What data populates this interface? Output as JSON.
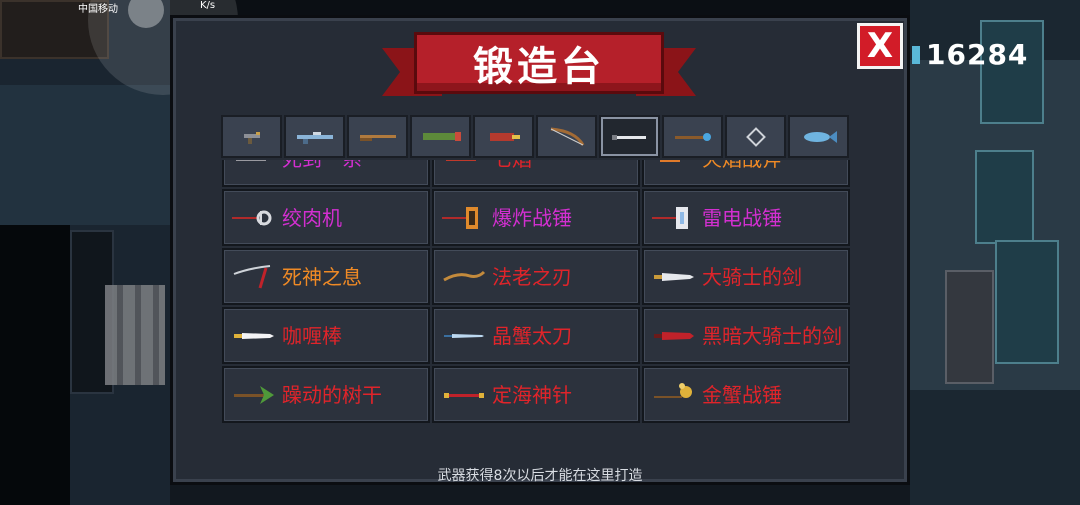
{
  "status_bar": {
    "carrier": "中国移动",
    "speed": "K/s"
  },
  "forge": {
    "title": "锻造台",
    "close_label": "X",
    "coins": "16284",
    "footer_note": "武器获得8次以后才能在这里打造",
    "tabs": [
      {
        "icon": "pistol-icon"
      },
      {
        "icon": "rifle-icon"
      },
      {
        "icon": "shotgun-icon"
      },
      {
        "icon": "launcher-icon"
      },
      {
        "icon": "laser-gun-icon"
      },
      {
        "icon": "bow-icon"
      },
      {
        "icon": "sword-icon",
        "active": true
      },
      {
        "icon": "staff-icon"
      },
      {
        "icon": "shuriken-icon"
      },
      {
        "icon": "fish-icon"
      }
    ],
    "weapons_partial_row": [
      {
        "name": "死到一系",
        "color": "magenta"
      },
      {
        "name": "七焰",
        "color": "red"
      },
      {
        "name": "火焰战斧",
        "color": "orange"
      }
    ],
    "weapons": [
      {
        "name": "绞肉机",
        "color": "magenta",
        "icon": "meat-grinder-icon"
      },
      {
        "name": "爆炸战锤",
        "color": "magenta",
        "icon": "explosive-hammer-icon"
      },
      {
        "name": "雷电战锤",
        "color": "magenta",
        "icon": "thunder-hammer-icon"
      },
      {
        "name": "死神之息",
        "color": "orange",
        "icon": "scythe-icon"
      },
      {
        "name": "法老之刃",
        "color": "red",
        "icon": "pharaoh-blade-icon"
      },
      {
        "name": "大骑士的剑",
        "color": "red",
        "icon": "knight-sword-icon"
      },
      {
        "name": "咖喱棒",
        "color": "red",
        "icon": "curry-stick-icon"
      },
      {
        "name": "晶蟹太刀",
        "color": "red",
        "icon": "crystal-katana-icon"
      },
      {
        "name": "黑暗大骑士的剑",
        "color": "red",
        "icon": "dark-knight-sword-icon"
      },
      {
        "name": "躁动的树干",
        "color": "red",
        "icon": "tree-trunk-icon"
      },
      {
        "name": "定海神针",
        "color": "red",
        "icon": "golden-staff-icon"
      },
      {
        "name": "金蟹战锤",
        "color": "red",
        "icon": "gold-crab-hammer-icon"
      }
    ]
  }
}
